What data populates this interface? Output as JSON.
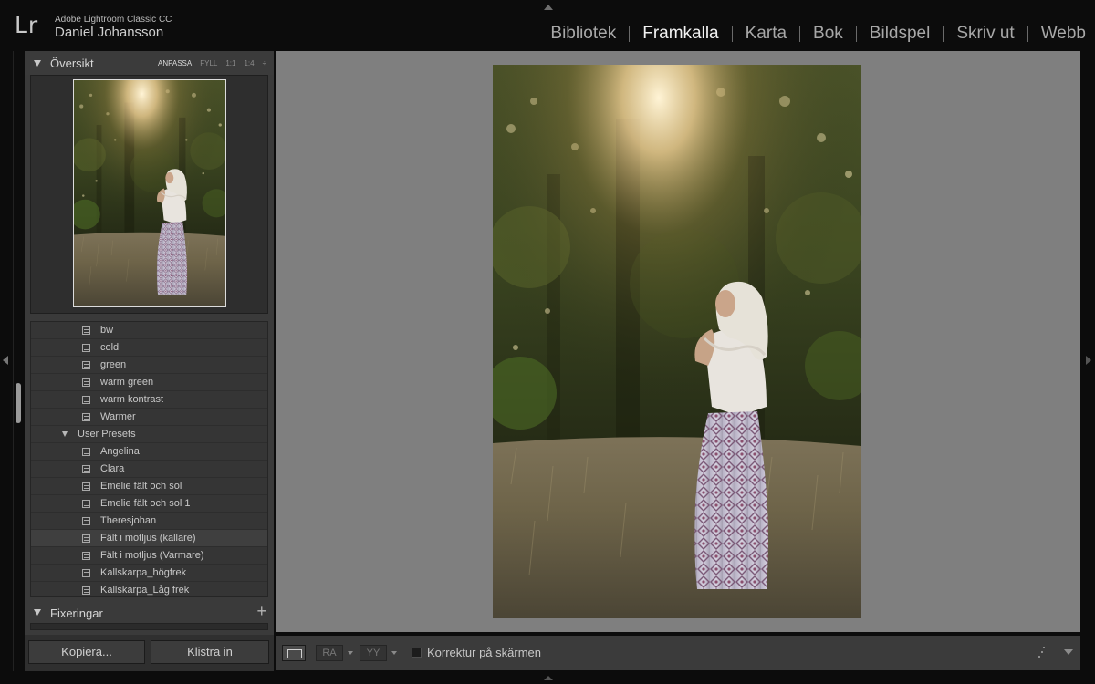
{
  "identity": {
    "logo": "Lr",
    "app_name": "Adobe Lightroom Classic CC",
    "user_name": "Daniel Johansson"
  },
  "modules": [
    {
      "label": "Bibliotek",
      "active": false
    },
    {
      "label": "Framkalla",
      "active": true
    },
    {
      "label": "Karta",
      "active": false
    },
    {
      "label": "Bok",
      "active": false
    },
    {
      "label": "Bildspel",
      "active": false
    },
    {
      "label": "Skriv ut",
      "active": false
    },
    {
      "label": "Webb",
      "active": false
    }
  ],
  "navigator": {
    "title": "Översikt",
    "zoom_options": [
      "ANPASSA",
      "FYLL",
      "1:1",
      "1:4"
    ],
    "zoom_active": "ANPASSA",
    "zoom_stepper": "÷"
  },
  "presets": {
    "items_top": [
      "bw",
      "cold",
      "green",
      "warm green",
      "warm kontrast",
      "Warmer"
    ],
    "folder": "User Presets",
    "items_user": [
      "Angelina",
      "Clara",
      "Emelie fält och sol",
      "Emelie fält och sol 1",
      "Theresjohan",
      "Fält i motljus (kallare)",
      "Fält i motljus (Varmare)",
      "Kallskarpa_högfrek",
      "Kallskarpa_Låg frek"
    ],
    "highlighted": "Fält i motljus (kallare)"
  },
  "snapshots": {
    "title": "Fixeringar",
    "add_symbol": "+"
  },
  "buttons": {
    "copy": "Kopiera...",
    "paste": "Klistra in"
  },
  "toolbar": {
    "ra_label": "RA",
    "yy_label": "YY",
    "soft_proof_label": "Korrektur på skärmen",
    "soft_proof_checked": false
  },
  "colors": {
    "background": "#0c0c0c",
    "panel": "#3a3a3a",
    "canvas": "#7f7f7f",
    "active_module": "#f2f2f2"
  }
}
